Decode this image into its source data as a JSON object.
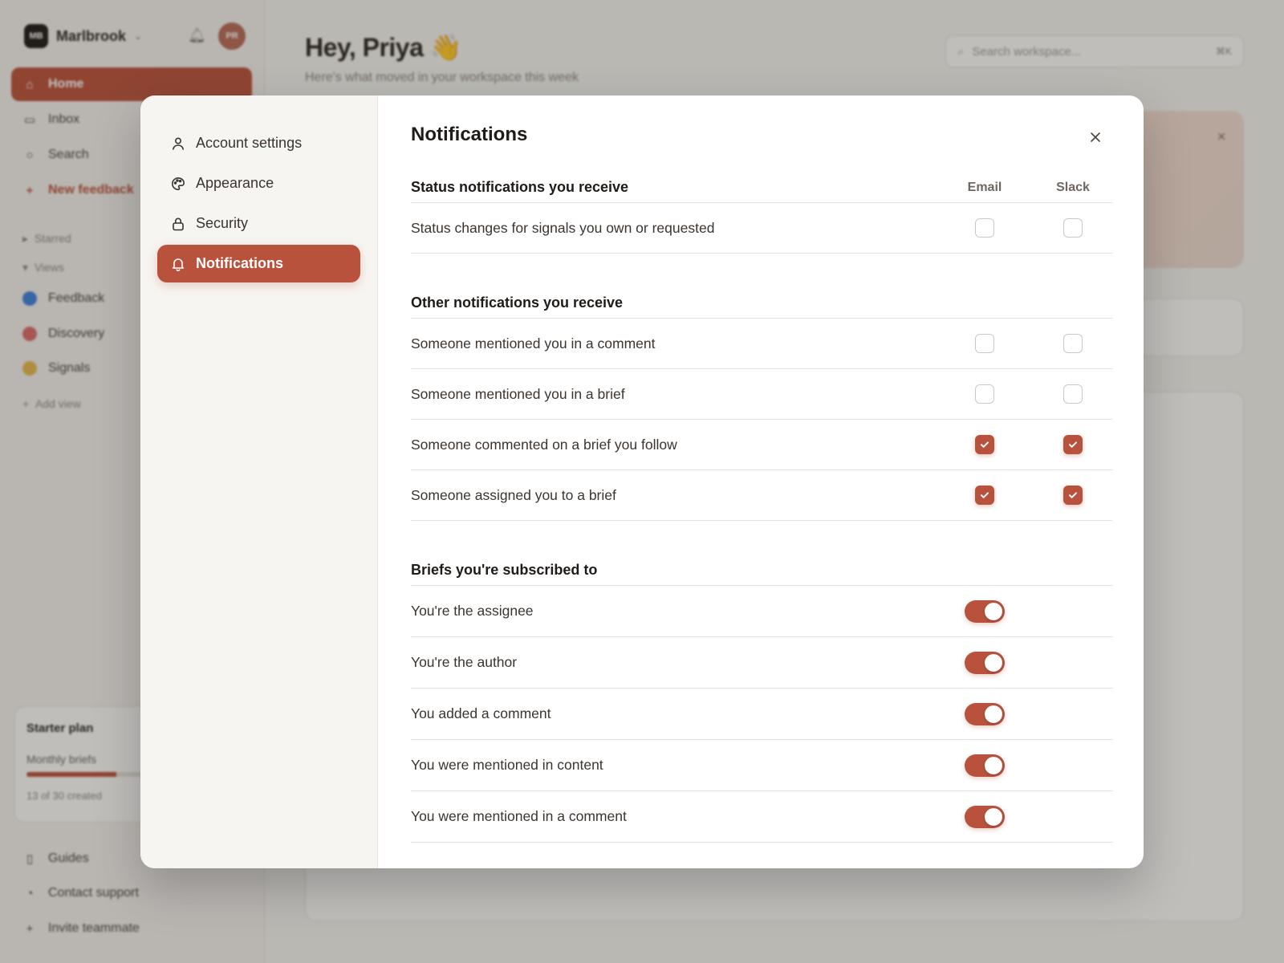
{
  "background": {
    "workspace": {
      "logo": "MB",
      "name": "Marlbrook"
    },
    "avatar_initials": "PR",
    "nav": [
      {
        "label": "Home",
        "icon": "home-icon"
      },
      {
        "label": "Inbox",
        "icon": "inbox-icon"
      },
      {
        "label": "Search",
        "icon": "search-icon"
      },
      {
        "label": "New feedback",
        "icon": "plus-icon"
      }
    ],
    "sections": {
      "starred": "Starred",
      "views": "Views"
    },
    "views": [
      {
        "label": "Feedback",
        "color": "#3f7fd9"
      },
      {
        "label": "Discovery",
        "color": "#d96a6a"
      },
      {
        "label": "Signals",
        "color": "#e2b84a"
      }
    ],
    "add_view": "Add view",
    "plan": {
      "title": "Starter plan",
      "subtitle": "Monthly briefs",
      "count": "13 of 30 created",
      "progress": 0.43
    },
    "footer": [
      "Guides",
      "Contact support",
      "Invite teammate"
    ],
    "greeting": "Hey, Priya 👋",
    "greeting_sub": "Here's what moved in your workspace this week",
    "search_placeholder": "Search workspace...",
    "search_kbd": "⌘K"
  },
  "modal": {
    "nav": [
      {
        "label": "Account settings",
        "icon": "user-icon"
      },
      {
        "label": "Appearance",
        "icon": "palette-icon"
      },
      {
        "label": "Security",
        "icon": "lock-icon"
      },
      {
        "label": "Notifications",
        "icon": "bell-icon",
        "active": true
      }
    ],
    "title": "Notifications",
    "columns": {
      "email": "Email",
      "slack": "Slack"
    },
    "status_section": {
      "title": "Status notifications you receive",
      "rows": [
        {
          "label": "Status changes for signals you own or requested",
          "email": false,
          "slack": false
        }
      ]
    },
    "other_section": {
      "title": "Other notifications you receive",
      "rows": [
        {
          "label": "Someone mentioned you in a comment",
          "email": false,
          "slack": false
        },
        {
          "label": "Someone mentioned you in a brief",
          "email": false,
          "slack": false
        },
        {
          "label": "Someone commented on a brief you follow",
          "email": true,
          "slack": true
        },
        {
          "label": "Someone assigned you to a brief",
          "email": true,
          "slack": true
        }
      ]
    },
    "briefs_section": {
      "title": "Briefs you're subscribed to",
      "rows": [
        {
          "label": "You're the assignee",
          "on": true
        },
        {
          "label": "You're the author",
          "on": true
        },
        {
          "label": "You added a comment",
          "on": true
        },
        {
          "label": "You were mentioned in content",
          "on": true
        },
        {
          "label": "You were mentioned in a comment",
          "on": true
        }
      ]
    }
  }
}
